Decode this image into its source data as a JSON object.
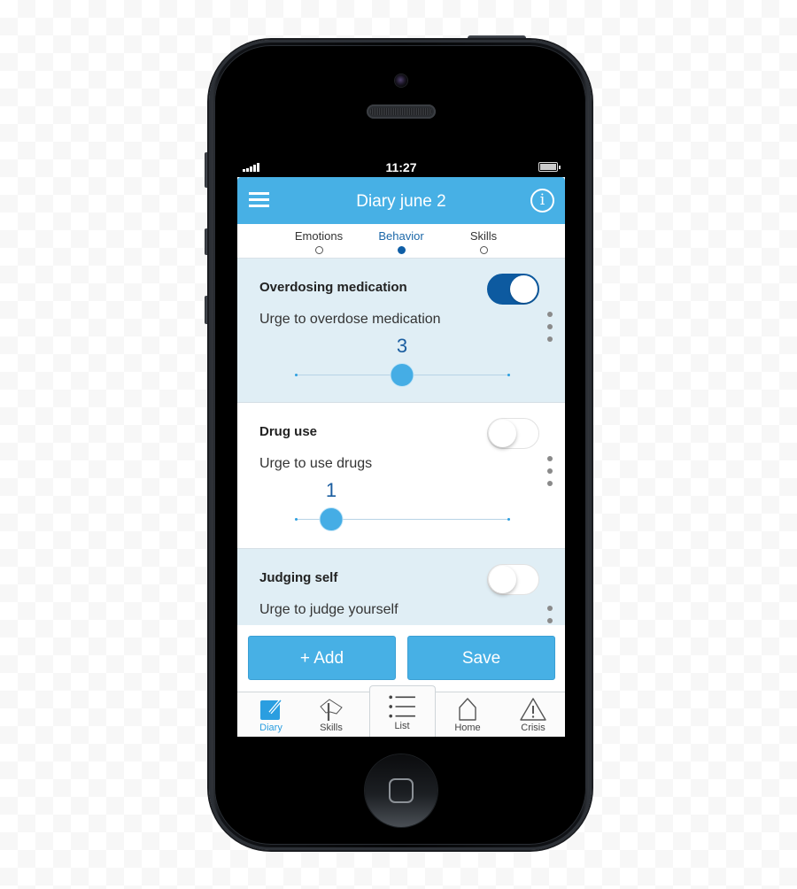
{
  "status_bar": {
    "time": "11:27",
    "signal_icon": "signal-bars-icon",
    "battery_icon": "battery-icon"
  },
  "app_bar": {
    "title": "Diary june 2",
    "menu_icon": "hamburger-menu-icon",
    "info_icon": "info-icon",
    "info_glyph": "i"
  },
  "tabs": [
    {
      "label": "Emotions",
      "active": false
    },
    {
      "label": "Behavior",
      "active": true
    },
    {
      "label": "Skills",
      "active": false
    }
  ],
  "behaviors": [
    {
      "name": "Overdosing medication",
      "enabled": true,
      "urge_label": "Urge to overdose medication",
      "urge_value": "3",
      "urge_fraction": 0.5
    },
    {
      "name": "Drug use",
      "enabled": false,
      "urge_label": "Urge to use drugs",
      "urge_value": "1",
      "urge_fraction": 0.1667
    },
    {
      "name": "Judging self",
      "enabled": false,
      "urge_label": "Urge to judge yourself"
    }
  ],
  "actions": {
    "add_label": "+ Add",
    "save_label": "Save"
  },
  "bottom_nav": [
    {
      "label": "Diary",
      "icon": "diary-pencil-icon",
      "active": true
    },
    {
      "label": "Skills",
      "icon": "skills-flag-icon",
      "active": false
    },
    {
      "label": "List",
      "icon": "list-icon",
      "active": false
    },
    {
      "label": "Home",
      "icon": "home-icon",
      "active": false
    },
    {
      "label": "Crisis",
      "icon": "warning-triangle-icon",
      "active": false
    }
  ],
  "colors": {
    "primary": "#47b0e5",
    "toggle_on": "#0d5aa0",
    "value_text": "#1b5ea0",
    "shaded_card": "#e0eef5",
    "active_nav": "#2a9ee0"
  }
}
